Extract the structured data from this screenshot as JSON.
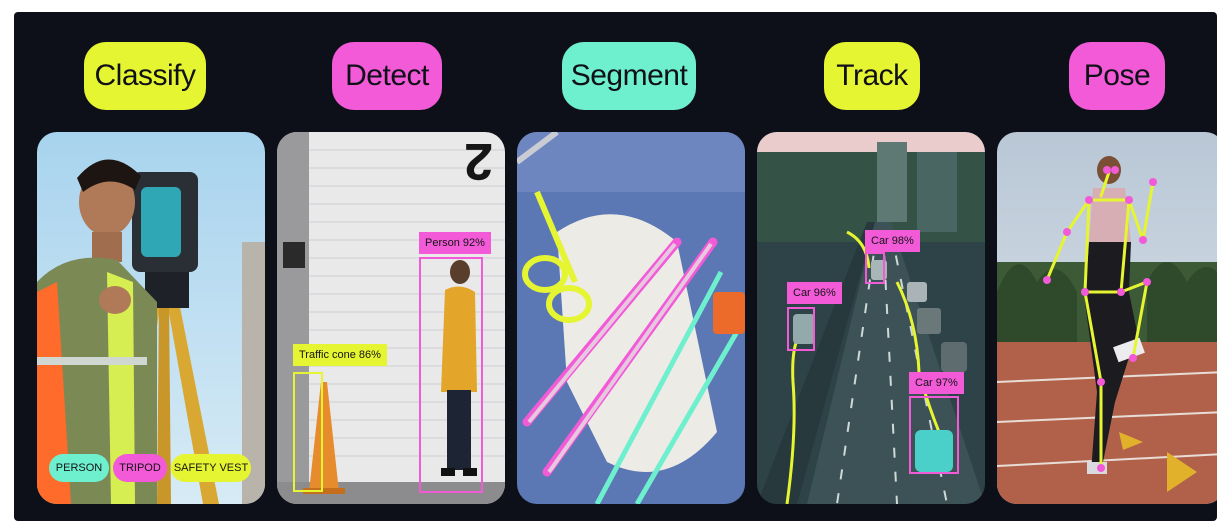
{
  "colors": {
    "yellow": "#e6f531",
    "pink": "#f25ad8",
    "teal": "#6ef0cf",
    "background": "#0d1019"
  },
  "tasks": [
    {
      "label": "Classify",
      "color": "#e6f531"
    },
    {
      "label": "Detect",
      "color": "#f25ad8"
    },
    {
      "label": "Segment",
      "color": "#6ef0cf"
    },
    {
      "label": "Track",
      "color": "#e6f531"
    },
    {
      "label": "Pose",
      "color": "#f25ad8"
    }
  ],
  "classify": {
    "chips": [
      "PERSON",
      "TRIPOD",
      "SAFETY VEST"
    ]
  },
  "detect": {
    "person_label": "Person  92%",
    "cone_label": "Traffic cone  86%"
  },
  "track": {
    "car1_label": "Car  98%",
    "car2_label": "Car  96%",
    "car3_label": "Car  97%"
  },
  "icons": {
    "classify": "surveyor-photo-icon",
    "detect": "pedestrian-street-photo-icon",
    "segment": "surgical-tools-photo-icon",
    "track": "highway-traffic-photo-icon",
    "pose": "runner-photo-icon"
  }
}
